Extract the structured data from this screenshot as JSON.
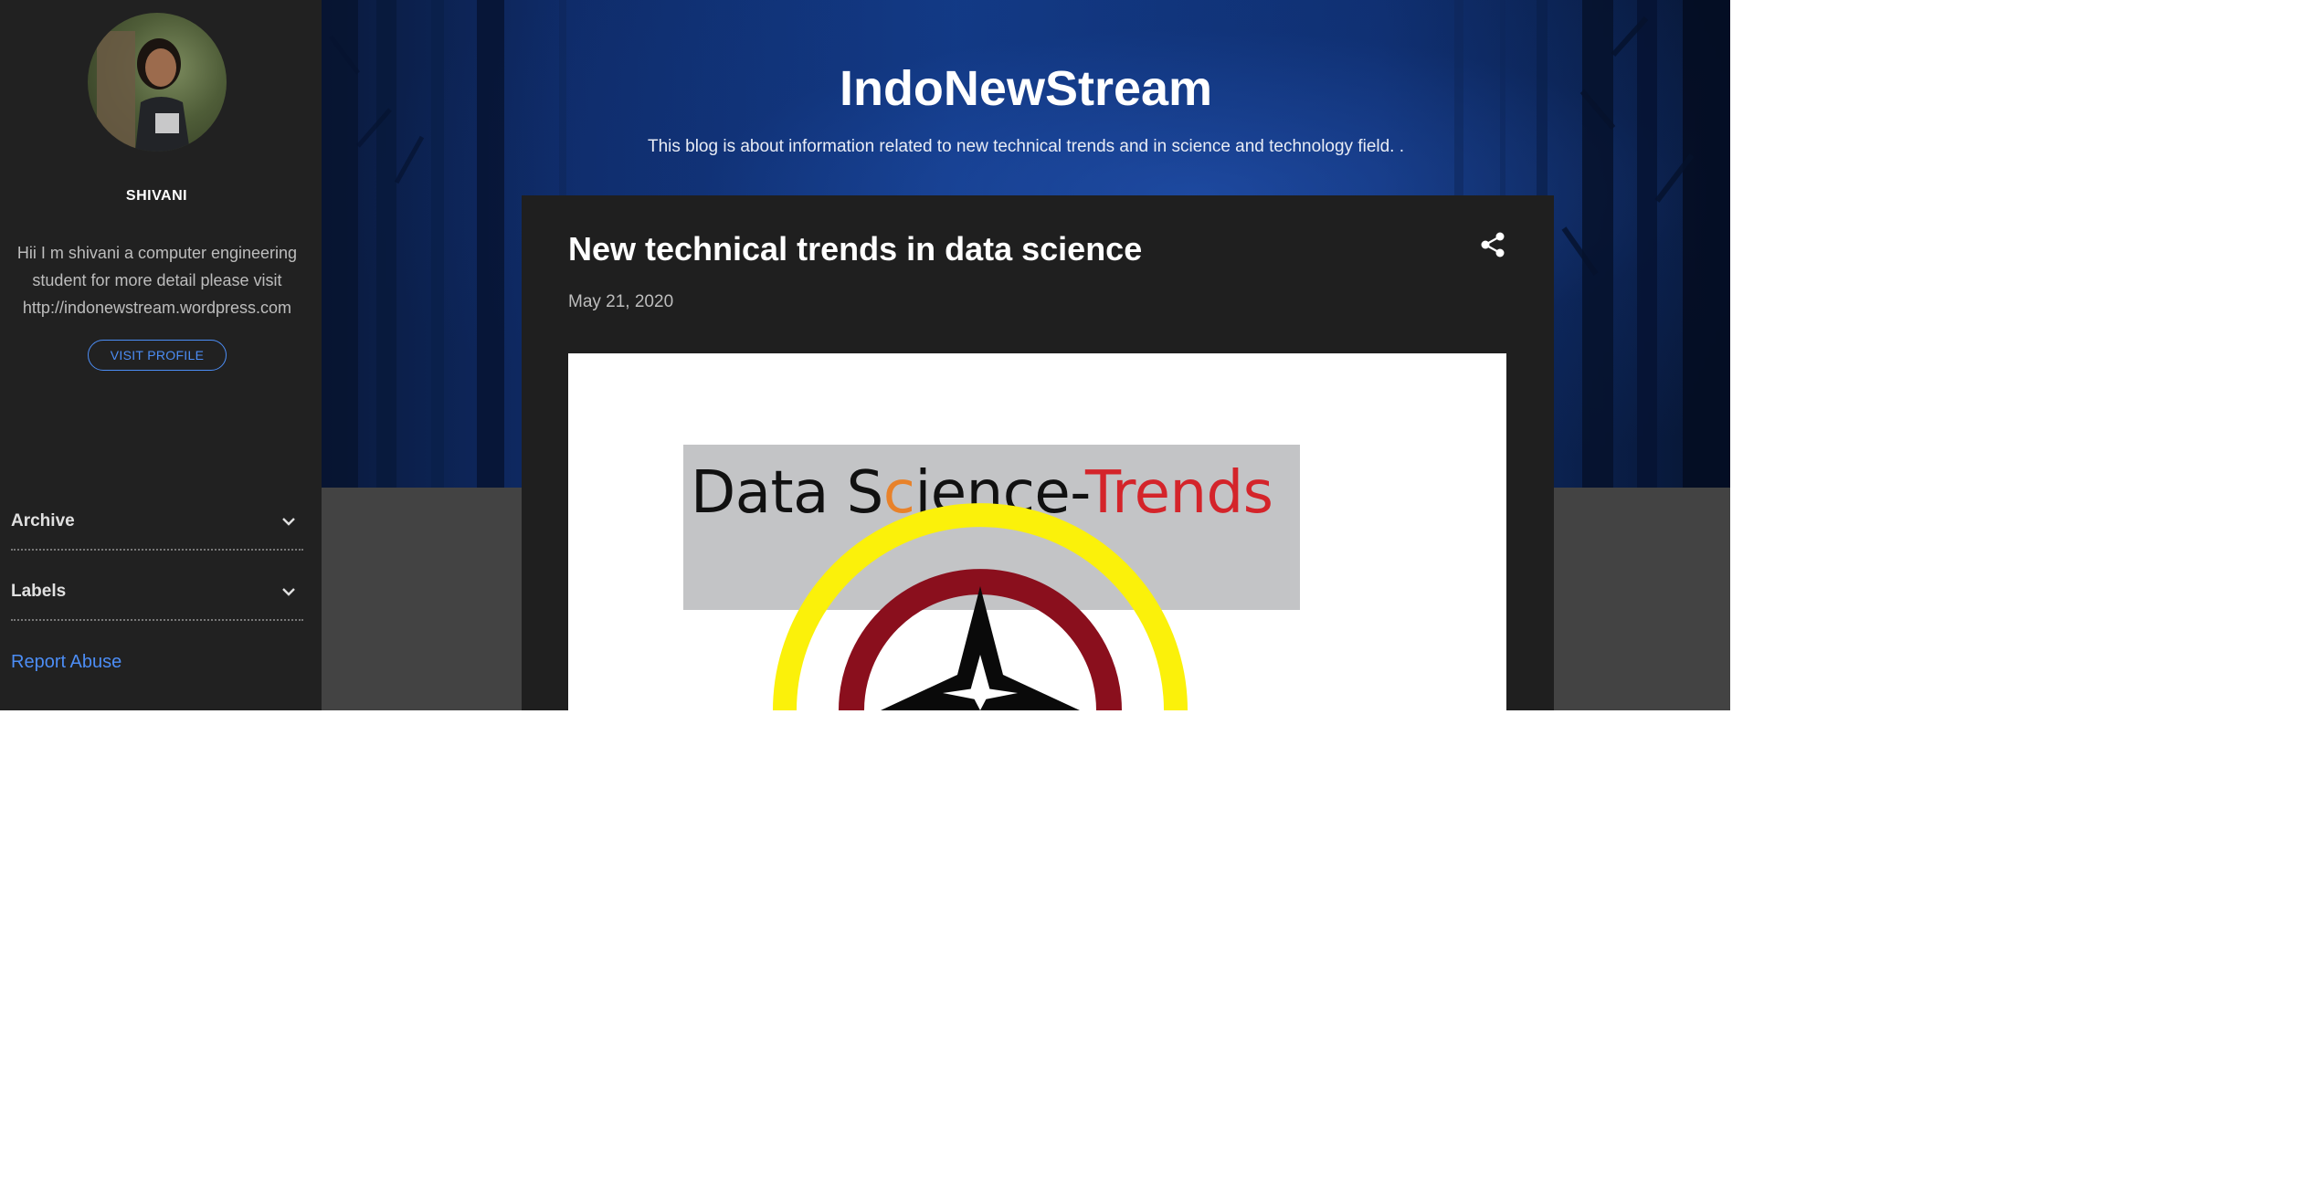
{
  "sidebar": {
    "profile_name": "SHIVANI",
    "profile_about": "Hii I m shivani a computer engineering student for more detail please visit http://indonewstream.wordpress.com",
    "visit_profile_label": "VISIT PROFILE",
    "widgets": [
      {
        "label": "Archive",
        "icon": "chevron-down-icon"
      },
      {
        "label": "Labels",
        "icon": "chevron-down-icon"
      }
    ],
    "report_abuse_label": "Report Abuse"
  },
  "header": {
    "blog_title": "IndoNewStream",
    "blog_description": "This blog is about information related to new technical trends and in science and technology field. ."
  },
  "post": {
    "title": "New technical trends in data science",
    "date": "May 21, 2020",
    "share_icon": "share-icon",
    "image": {
      "banner_text_parts": [
        "Data S",
        "c",
        "ience-",
        "Trends"
      ],
      "banner_colors": {
        "text": "#111111",
        "accent_orange": "#e8822a",
        "accent_red": "#d4242a"
      }
    }
  },
  "colors": {
    "sidebar_bg": "#212121",
    "card_bg": "#1f1f1f",
    "page_bg": "#434343",
    "link": "#4c8df5"
  }
}
